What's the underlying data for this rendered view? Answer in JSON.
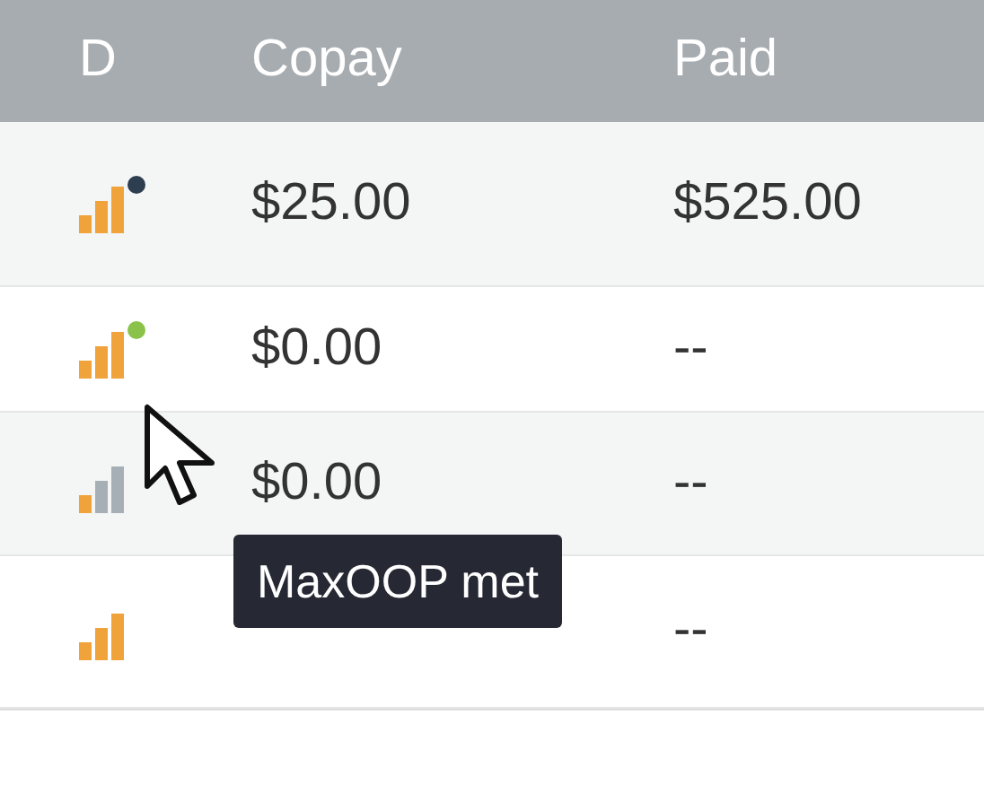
{
  "table": {
    "columns": [
      "D",
      "Copay",
      "Paid"
    ],
    "rows": [
      {
        "kind": "full",
        "color": "#2d3e50",
        "copay": "$25.00",
        "paid": "$525.00"
      },
      {
        "kind": "full",
        "color": "#8bc34a",
        "copay": "$0.00",
        "paid": "--"
      },
      {
        "kind": "partial",
        "copay": "$0.00",
        "paid": "--"
      },
      {
        "kind": "full",
        "paid": "--"
      }
    ]
  },
  "tooltip": {
    "text": "MaxOOP met"
  }
}
